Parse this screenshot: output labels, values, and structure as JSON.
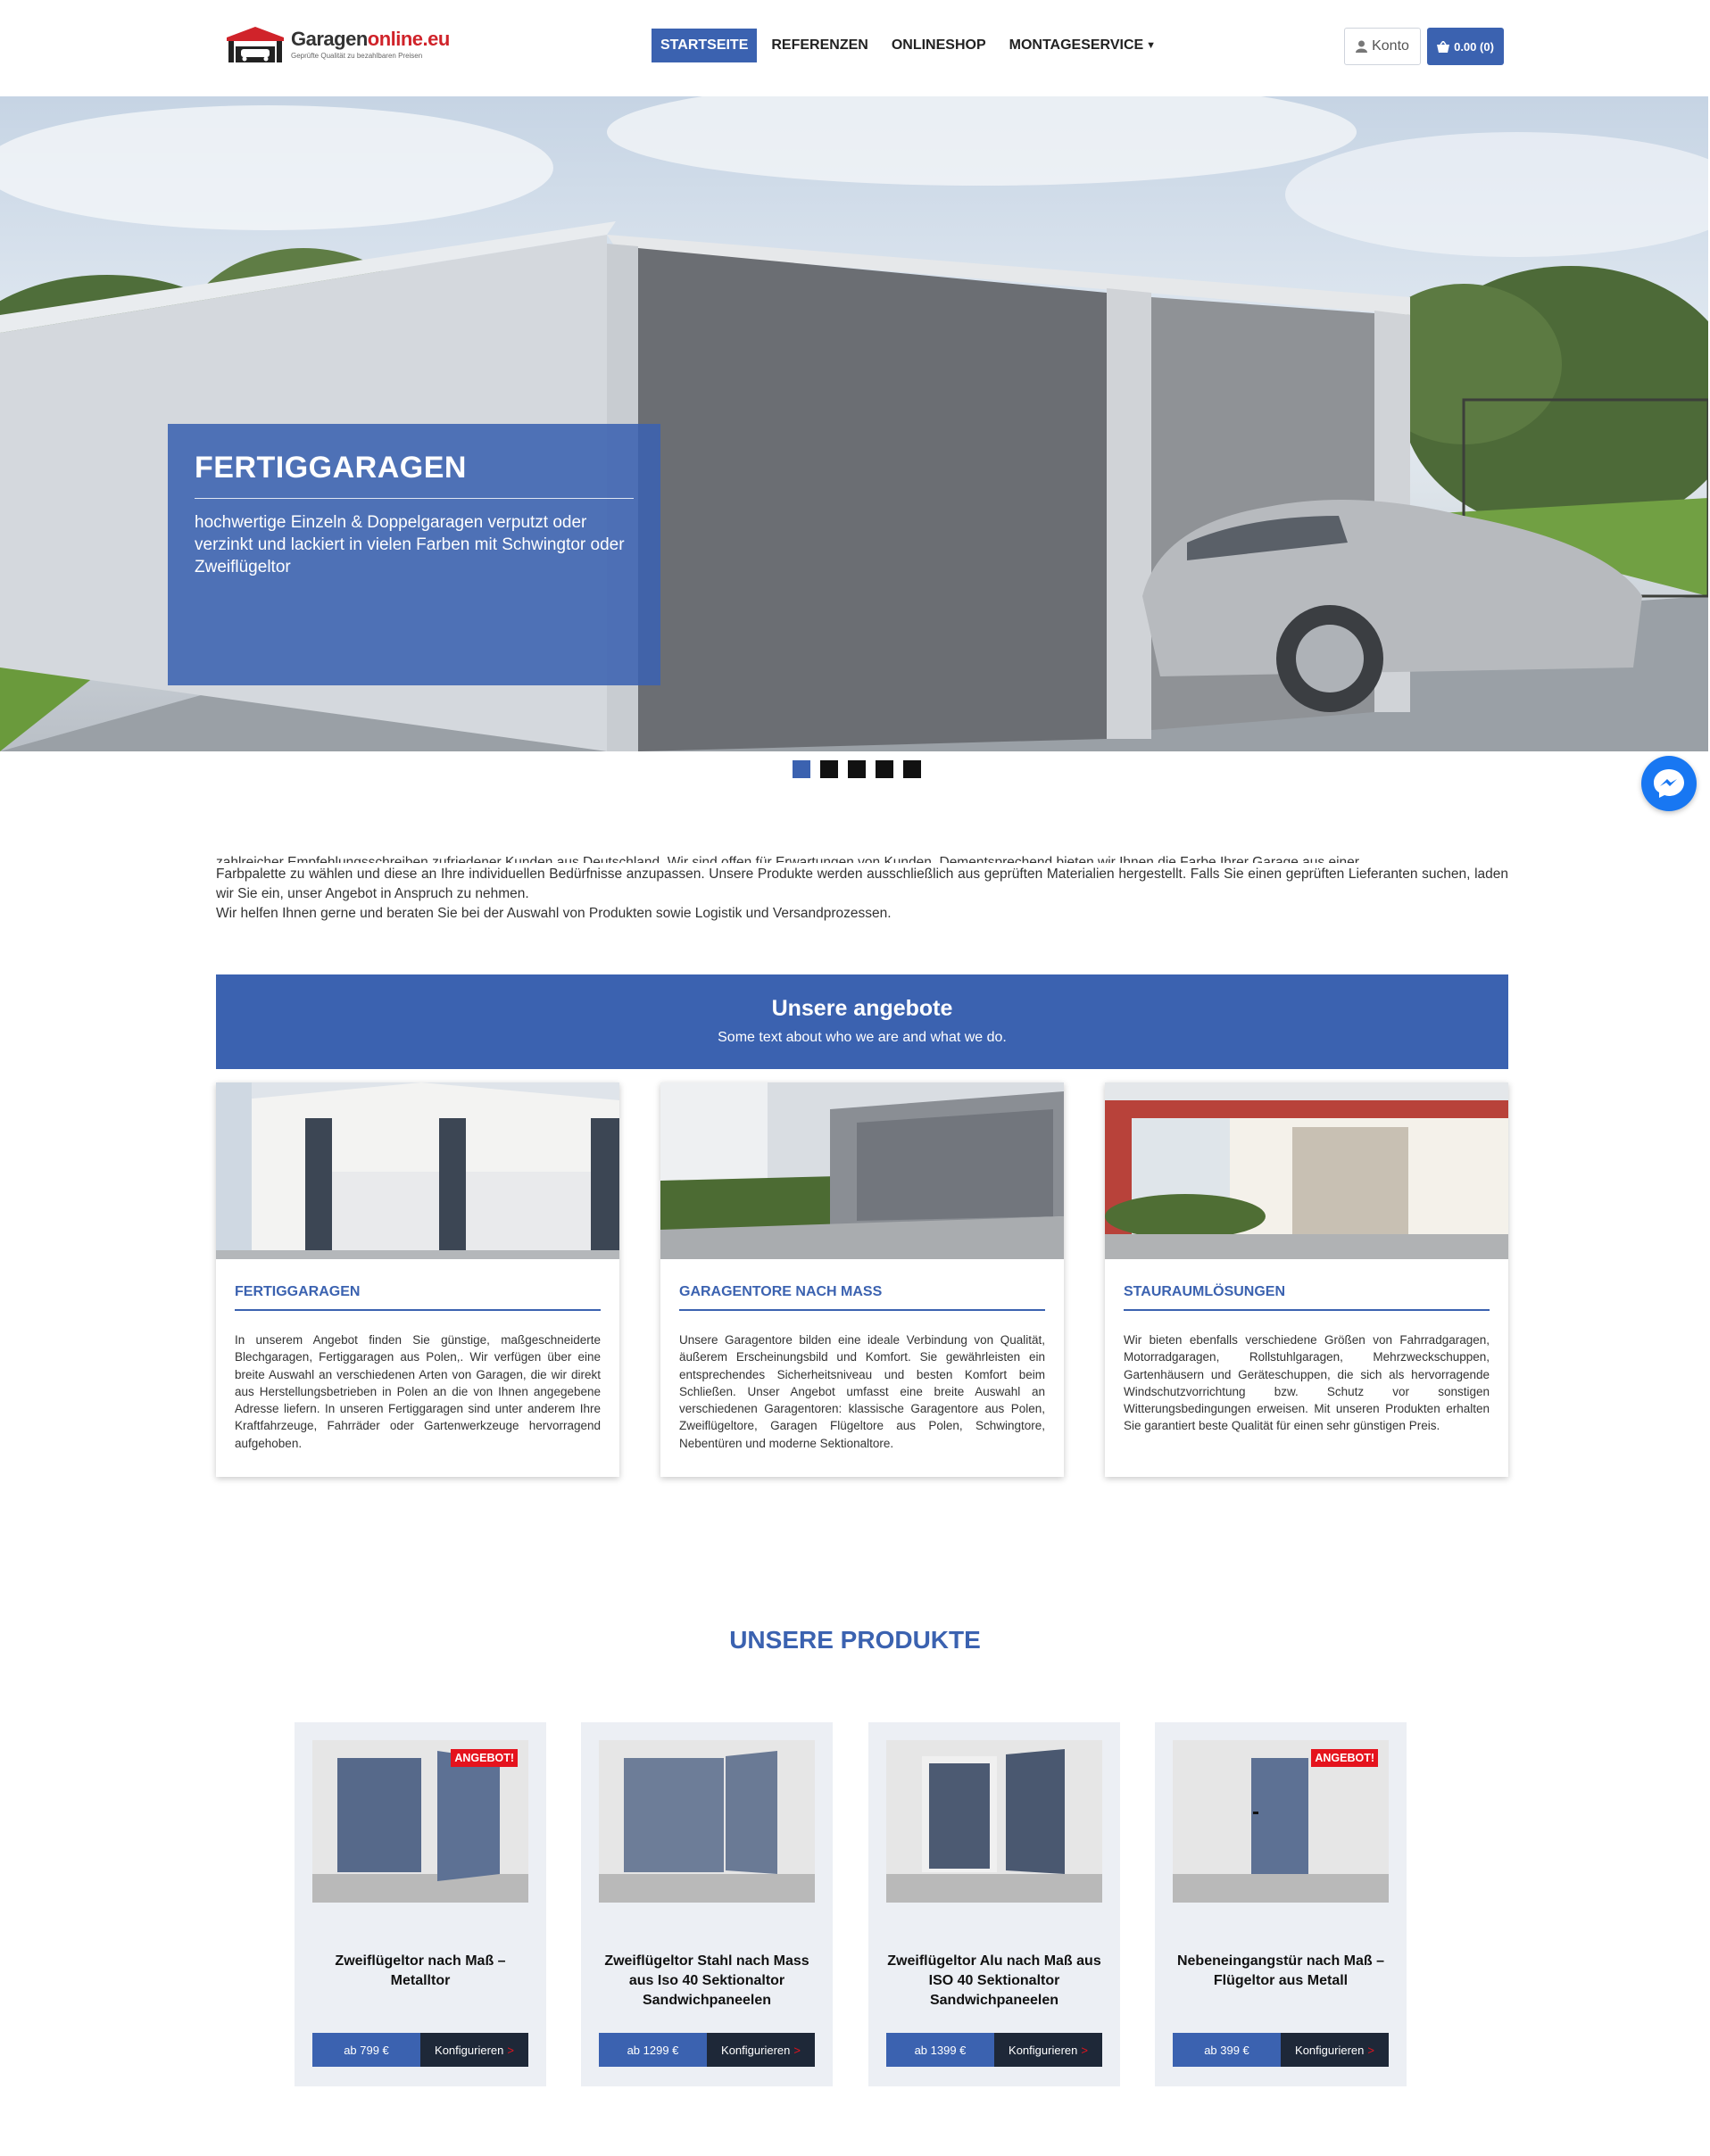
{
  "header": {
    "logo_name_a": "Garagen",
    "logo_name_b": "online.eu",
    "logo_tagline": "Geprüfte Qualität zu bezahlbaren Preisen",
    "nav": [
      {
        "label": "STARTSEITE",
        "active": true
      },
      {
        "label": "REFERENZEN"
      },
      {
        "label": "ONLINESHOP"
      },
      {
        "label": "MONTAGESERVICE"
      }
    ],
    "account_label": "Konto",
    "cart_label": "0.00 (0)",
    "icons": [
      "user-icon",
      "shopping-basket-icon",
      "caret-down-icon"
    ]
  },
  "hero": {
    "title": "FERTIGGARAGEN",
    "text": "hochwertige Einzeln & Doppelgaragen verputzt oder verzinkt und lackiert in vielen Farben mit Schwingtor oder Zweiflügeltor",
    "slide_count": 5,
    "active_slide": 1
  },
  "intro": {
    "line_partial": "zahlreicher Empfehlungsschreiben zufriedener Kunden aus Deutschland. Wir sind offen für Erwartungen von Kunden. Dementsprechend bieten wir Ihnen die Farbe Ihrer Garage aus einer",
    "paragraph": "Farbpalette zu wählen und diese an Ihre individuellen Bedürfnisse anzupassen. Unsere Produkte werden ausschließlich aus geprüften Materialien hergestellt. Falls Sie einen geprüften Liefe­ranten suchen, laden wir Sie ein, unser Angebot in Anspruch zu nehmen.",
    "paragraph2": "Wir helfen Ihnen gerne und beraten Sie bei der Auswahl von Produkten sowie Logistik und Versandprozessen."
  },
  "offers": {
    "title": "Unsere angebote",
    "subtitle": "Some text about who we are and what we do.",
    "cards": [
      {
        "title": "FERTIGGARAGEN",
        "text": "In unserem Angebot finden Sie günstige, maßgeschneiderte Blechgaragen, Fertiggaragen aus Polen,. Wir verfügen über eine breite Auswahl an verschiedenen Arten von Garagen, die wir direkt aus Herstellungsbetrieben in Polen an die von Ihnen angegebene Adresse liefern. In unseren Fertiggaragen sind unter anderem Ihre Kraftfahrzeuge, Fahrräder oder Gartenwerkzeuge hervorragend aufgehoben."
      },
      {
        "title": "GARAGENTORE NACH MAß",
        "text": "Unsere Garagentore bilden eine ideale Verbindung von Qualität, äußerem Erscheinungsbild und Komfort. Sie gewährleisten ein entsprechendes Sicherheitsniveau und besten Komfort beim Schließen. Unser Angebot umfasst eine breite Auswahl an verschiedenen Garagentoren: klassische Garagentore aus Polen, Zweiflügeltore, Garagen Flügeltore aus Polen, Schwingtore, Nebentüren und moderne Sektionaltore."
      },
      {
        "title": "STAURAUMLÖSUNGEN",
        "text": "Wir bieten ebenfalls verschiedene Größen von Fahrradgaragen, Motorradgaragen, Rollstuhlgaragen, Mehrzweckschuppen, Gartenhäusern und Geräteschuppen, die sich als hervorragende Windschutzvorrichtung bzw. Schutz vor sonstigen Witterungsbedingungen erweisen. Mit unseren Produkten erhalten Sie garantiert beste Qualität für einen sehr günstigen Preis."
      }
    ]
  },
  "products": {
    "title": "UNSERE PRODUKTE",
    "items": [
      {
        "name": "Zweiflügeltor nach Maß – Metalltor",
        "price": "ab 799 €",
        "button": "Konfigurieren",
        "badge": "ANGEBOT!"
      },
      {
        "name": "Zweiflügeltor Stahl nach Mass aus Iso 40 Sektionaltor Sandwichpaneelen",
        "price": "ab 1299 €",
        "button": "Konfigurieren",
        "badge": ""
      },
      {
        "name": "Zweiflügeltor Alu nach Maß aus ISO 40 Sektionaltor Sandwichpaneelen",
        "price": "ab 1399 €",
        "button": "Konfigurieren",
        "badge": ""
      },
      {
        "name": "Nebeneingangstür nach Maß – Flügeltor aus Metall",
        "price": "ab 399 €",
        "button": "Konfigurieren",
        "badge": "ANGEBOT!"
      }
    ],
    "config_arrow": ">"
  },
  "colors": {
    "brand_blue": "#3b62b0",
    "badge_red": "#e5131d",
    "dark_button": "#1e2838",
    "messenger_blue": "#1877f2"
  }
}
